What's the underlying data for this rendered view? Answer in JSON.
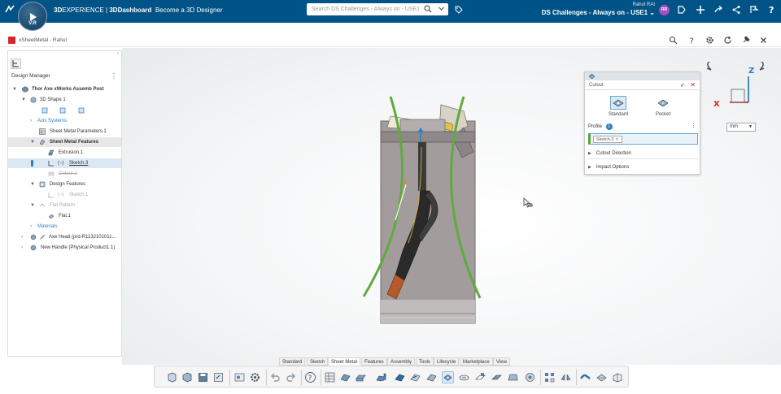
{
  "topbar": {
    "compass_initials": "V.R",
    "brand_prefix": "3D",
    "brand_experience": "EXPERIENCE",
    "brand_separator": " | ",
    "brand_app": "3DDashboard",
    "brand_tagline": "Become a 3D Designer",
    "search_placeholder": "Search DS Challenges - Always on - USE1",
    "user_name": "Rahul RAI",
    "tenant": "DS Challenges - Always on - USE1",
    "avatar_initials": "RR",
    "colors": {
      "bar": "#005386",
      "avatar": "#a050c0"
    }
  },
  "app": {
    "title": "xSheetMetal - Rahul"
  },
  "tree": {
    "title": "Design Manager",
    "items": [
      {
        "label": "Thor Axe xWorks Assemb Post",
        "icon": "product-icon"
      },
      {
        "label": "3D Shape 1",
        "icon": "shape-icon"
      },
      {
        "label": "Axis Systems",
        "icon": "folder-icon"
      },
      {
        "label": "Sheet Metal Parameters.1",
        "icon": "parameters-icon"
      },
      {
        "label": "Sheet Metal Features",
        "icon": "sheet-metal-icon"
      },
      {
        "label": "Extrusion.1",
        "icon": "extrusion-icon"
      },
      {
        "label": "Sketch.3",
        "icon": "sketch-icon"
      },
      {
        "label": "Cutout.2",
        "icon": "cutout-icon"
      },
      {
        "label": "Design Features",
        "icon": "features-icon"
      },
      {
        "label": "Sketch.1",
        "icon": "sketch-icon"
      },
      {
        "label": "Flat Pattern",
        "icon": "flat-pattern-icon"
      },
      {
        "label": "Flat.1",
        "icon": "flat-icon"
      },
      {
        "label": "Materials",
        "icon": "materials-icon"
      },
      {
        "label": "Axe Head (prd-R1132101011...",
        "icon": "part-icon"
      },
      {
        "label": "New Handle (Physical Product1.1)",
        "icon": "part-icon"
      }
    ]
  },
  "cutout_panel": {
    "title": "Cutout",
    "options": [
      {
        "label": "Standard",
        "selected": true
      },
      {
        "label": "Pocket",
        "selected": false
      }
    ],
    "profile_label": "Profile",
    "profile_count": "1",
    "profile_chip": "Sketch.3",
    "sections": [
      "Cutout Direction",
      "Impact Options"
    ]
  },
  "units": {
    "value": "mm"
  },
  "axes": {
    "x": "X",
    "z": "Z"
  },
  "section_tabs": [
    {
      "label": "Standard",
      "active": false
    },
    {
      "label": "Sketch",
      "active": false
    },
    {
      "label": "Sheet Metal",
      "active": true
    },
    {
      "label": "Features",
      "active": false
    },
    {
      "label": "Assembly",
      "active": false
    },
    {
      "label": "Tools",
      "active": false
    },
    {
      "label": "Lifecycle",
      "active": false
    },
    {
      "label": "Marketplace",
      "active": false
    },
    {
      "label": "View",
      "active": false
    }
  ]
}
